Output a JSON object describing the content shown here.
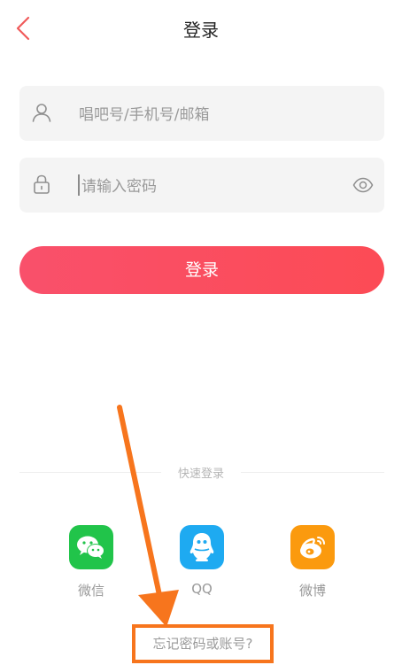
{
  "header": {
    "title": "登录",
    "back_icon": "chevron-left-icon"
  },
  "form": {
    "account_placeholder": "唱吧号/手机号/邮箱",
    "password_placeholder": "请输入密码",
    "account_icon": "user-icon",
    "password_icon": "lock-icon",
    "visibility_icon": "eye-icon",
    "submit_label": "登录"
  },
  "quick_login": {
    "label": "快速登录",
    "providers": [
      {
        "label": "微信",
        "icon": "wechat-icon",
        "color": "#21c44a"
      },
      {
        "label": "QQ",
        "icon": "qq-icon",
        "color": "#1eaaf1"
      },
      {
        "label": "微博",
        "icon": "weibo-icon",
        "color": "#fb9a0e"
      }
    ]
  },
  "forgot_label": "忘记密码或账号?",
  "colors": {
    "accent": "#fc4b55",
    "back_arrow": "#f05a5a",
    "annotation": "#f7751d"
  }
}
